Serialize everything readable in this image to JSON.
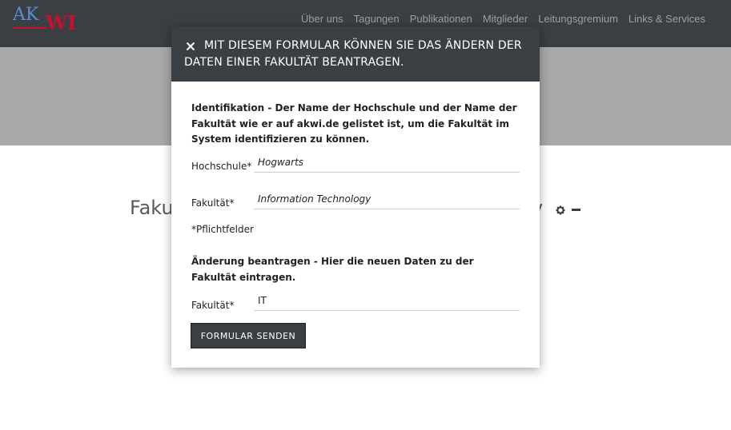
{
  "logo": {
    "ak": "AK",
    "wi": "WI"
  },
  "nav": {
    "items": [
      {
        "label": "Über uns"
      },
      {
        "label": "Tagungen"
      },
      {
        "label": "Publikationen"
      },
      {
        "label": "Mitglieder"
      },
      {
        "label": "Leitungsgremium"
      },
      {
        "label": "Links & Services"
      }
    ]
  },
  "page": {
    "title_start": "Faku",
    "title_end": "y",
    "icons": [
      "gear-icon",
      "minus-icon"
    ]
  },
  "modal": {
    "title": "Mit diesem Formular können Sie das Ändern der Daten einer Fakultät beantragen.",
    "close_icon": "close-icon",
    "identification_heading": "Identifikation - Der Name der Hochschule und der Name der Fakultät wie er auf akwi.de gelistet ist, um die Fakultät im System identifizieren zu können.",
    "fields": {
      "hochschule": {
        "label": "Hochschule*",
        "value": "Hogwarts"
      },
      "fakultaet": {
        "label": "Fakultät*",
        "value": "Information Technology"
      }
    },
    "required_note": "*Pflichtfelder",
    "change_heading": "Änderung beantragen - Hier die neuen Daten zu der Fakultät eintragen.",
    "new_fields": {
      "fakultaet": {
        "label": "Fakultät*",
        "value": "IT"
      }
    },
    "submit_label": "Formular senden"
  },
  "colors": {
    "navbar": "#3a3f44",
    "hero": "#a9a9a9",
    "accent_blue": "#5b8fd1",
    "accent_red": "#c8102e"
  }
}
